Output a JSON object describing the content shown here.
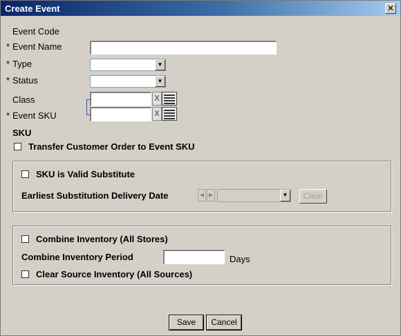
{
  "window": {
    "title": "Create Event",
    "close_glyph": "✕"
  },
  "form": {
    "event_code": {
      "label": "Event Code"
    },
    "event_name": {
      "required": "*",
      "label": "Event Name",
      "value": ""
    },
    "type": {
      "required": "*",
      "label": "Type",
      "value": ""
    },
    "status": {
      "required": "*",
      "label": "Status",
      "value": ""
    },
    "class": {
      "label": "Class",
      "value": ""
    },
    "event_sku": {
      "required": "*",
      "label": "Event SKU",
      "value": ""
    },
    "sku": {
      "label": "SKU"
    },
    "transfer": {
      "label": "Transfer Customer Order to Event SKU",
      "checked": false
    },
    "clear_glyph": "X"
  },
  "substitute_group": {
    "valid_substitute": {
      "label": "SKU is Valid Substitute",
      "checked": false
    },
    "earliest_date": {
      "label": "Earliest Substitution Delivery Date",
      "value": ""
    },
    "clear_button": "Clear"
  },
  "inventory_group": {
    "combine": {
      "label": "Combine Inventory (All Stores)",
      "checked": false
    },
    "period": {
      "label": "Combine Inventory Period",
      "value": "",
      "unit": "Days"
    },
    "clear_source": {
      "label": "Clear Source Inventory (All Sources)",
      "checked": false
    }
  },
  "buttons": {
    "save": "Save",
    "cancel": "Cancel"
  }
}
